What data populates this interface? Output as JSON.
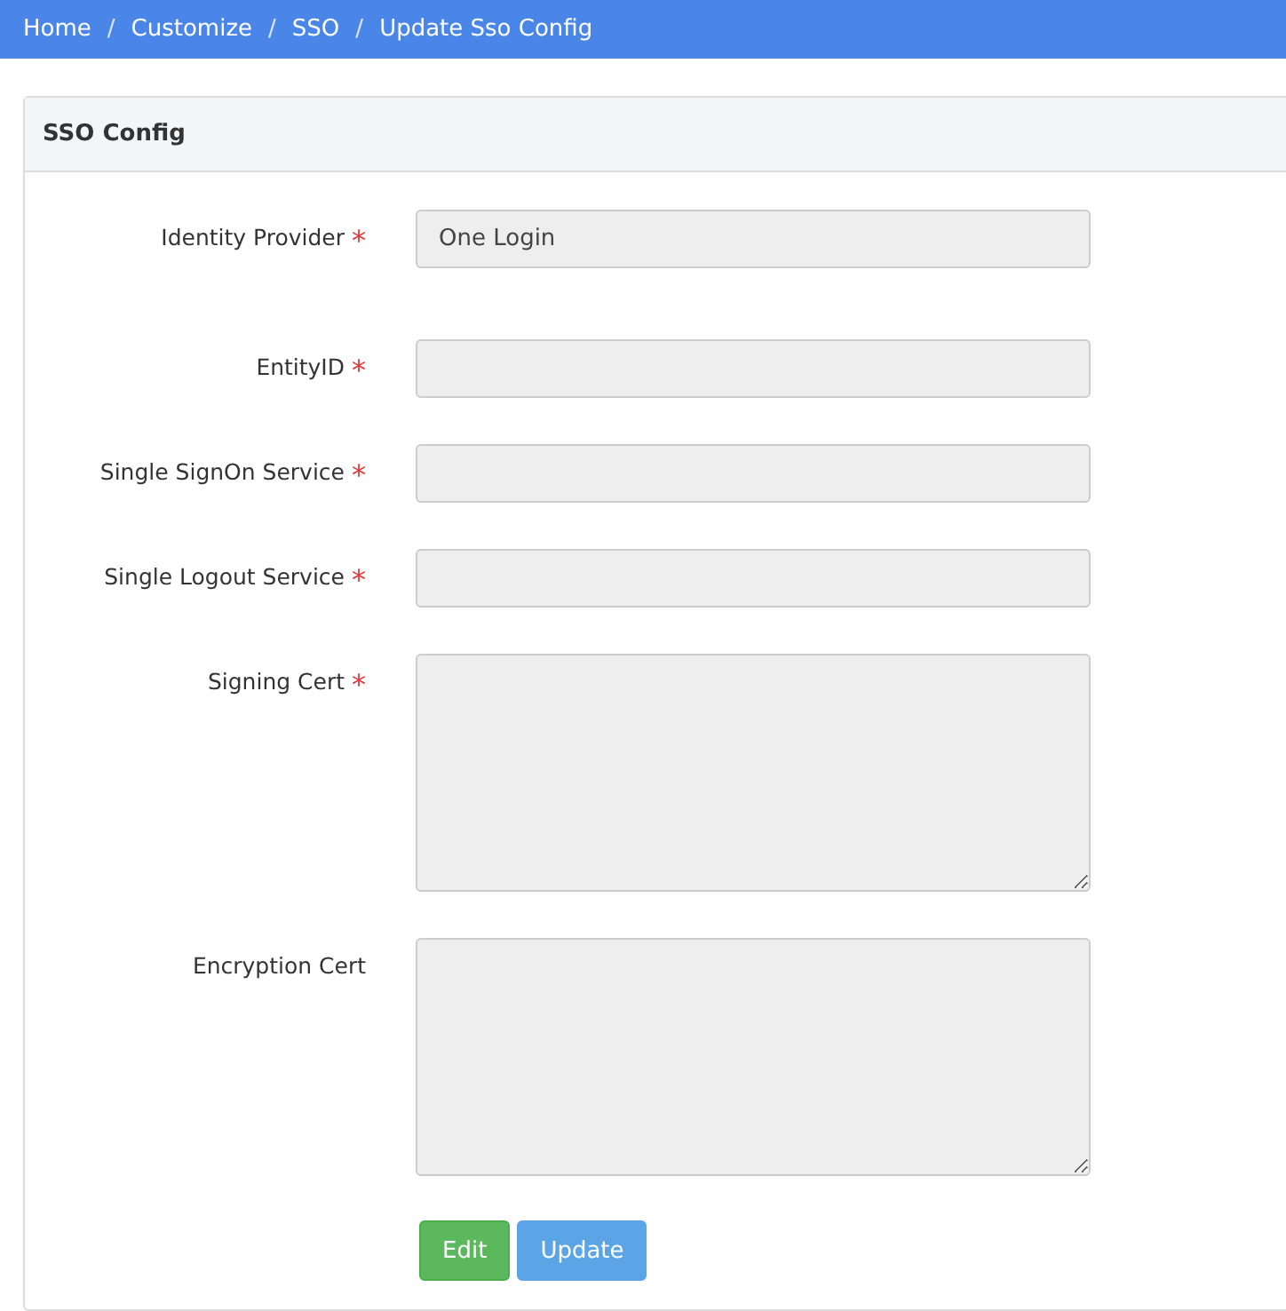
{
  "breadcrumb": [
    {
      "label": "Home"
    },
    {
      "separator": "/",
      "label": "Customize"
    },
    {
      "separator": "/",
      "label": "SSO"
    },
    {
      "separator": "/",
      "label": "Update Sso Config"
    }
  ],
  "panel": {
    "title": "SSO Config",
    "fields": [
      {
        "label": "Identity Provider",
        "required_mark": "*",
        "kind": "input",
        "value": "One Login",
        "disabled": true
      },
      {
        "label": "EntityID",
        "required_mark": "*",
        "kind": "input",
        "disabled": true
      },
      {
        "label": "Single SignOn Service",
        "required_mark": "*",
        "kind": "input",
        "disabled": true
      },
      {
        "label": "Single Logout Service",
        "required_mark": "*",
        "kind": "input",
        "disabled": true
      },
      {
        "label": "Signing Cert",
        "required_mark": "*",
        "kind": "textarea",
        "disabled": true
      },
      {
        "label": "Encryption Cert",
        "kind": "textarea",
        "disabled": true
      }
    ],
    "buttons": [
      {
        "label": "Edit",
        "kind": "success",
        "disabled": false
      },
      {
        "label": "Update",
        "kind": "primary",
        "disabled": true
      }
    ]
  }
}
